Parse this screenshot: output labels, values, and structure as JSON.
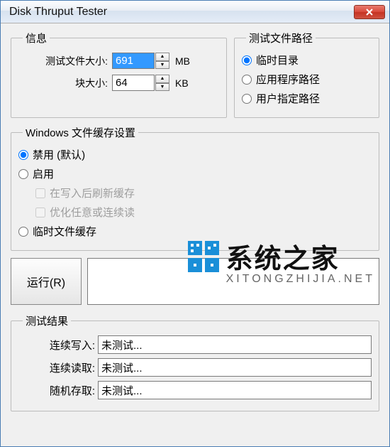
{
  "window": {
    "title": "Disk Thruput Tester"
  },
  "info_group": {
    "legend": "信息",
    "file_size_label": "测试文件大小:",
    "file_size_value": "691",
    "file_size_unit": "MB",
    "block_size_label": "块大小:",
    "block_size_value": "64",
    "block_size_unit": "KB"
  },
  "path_group": {
    "legend": "测试文件路径",
    "option_temp": "临时目录",
    "option_app": "应用程序路径",
    "option_user": "用户指定路径",
    "selected": "temp"
  },
  "cache_group": {
    "legend": "Windows 文件缓存设置",
    "option_disable": "禁用 (默认)",
    "option_enable": "启用",
    "sub_flush": "在写入后刷新缓存",
    "sub_optimize": "优化任意或连续读",
    "option_tempfile": "临时文件缓存",
    "selected": "disable"
  },
  "run": {
    "button_label": "运行(R)"
  },
  "results_group": {
    "legend": "测试结果",
    "seq_write_label": "连续写入:",
    "seq_write_value": "未测试...",
    "seq_read_label": "连续读取:",
    "seq_read_value": "未测试...",
    "rand_access_label": "随机存取:",
    "rand_access_value": "未测试..."
  },
  "watermark": {
    "main": "系统之家",
    "sub": "XITONGZHIJIA.NET"
  }
}
